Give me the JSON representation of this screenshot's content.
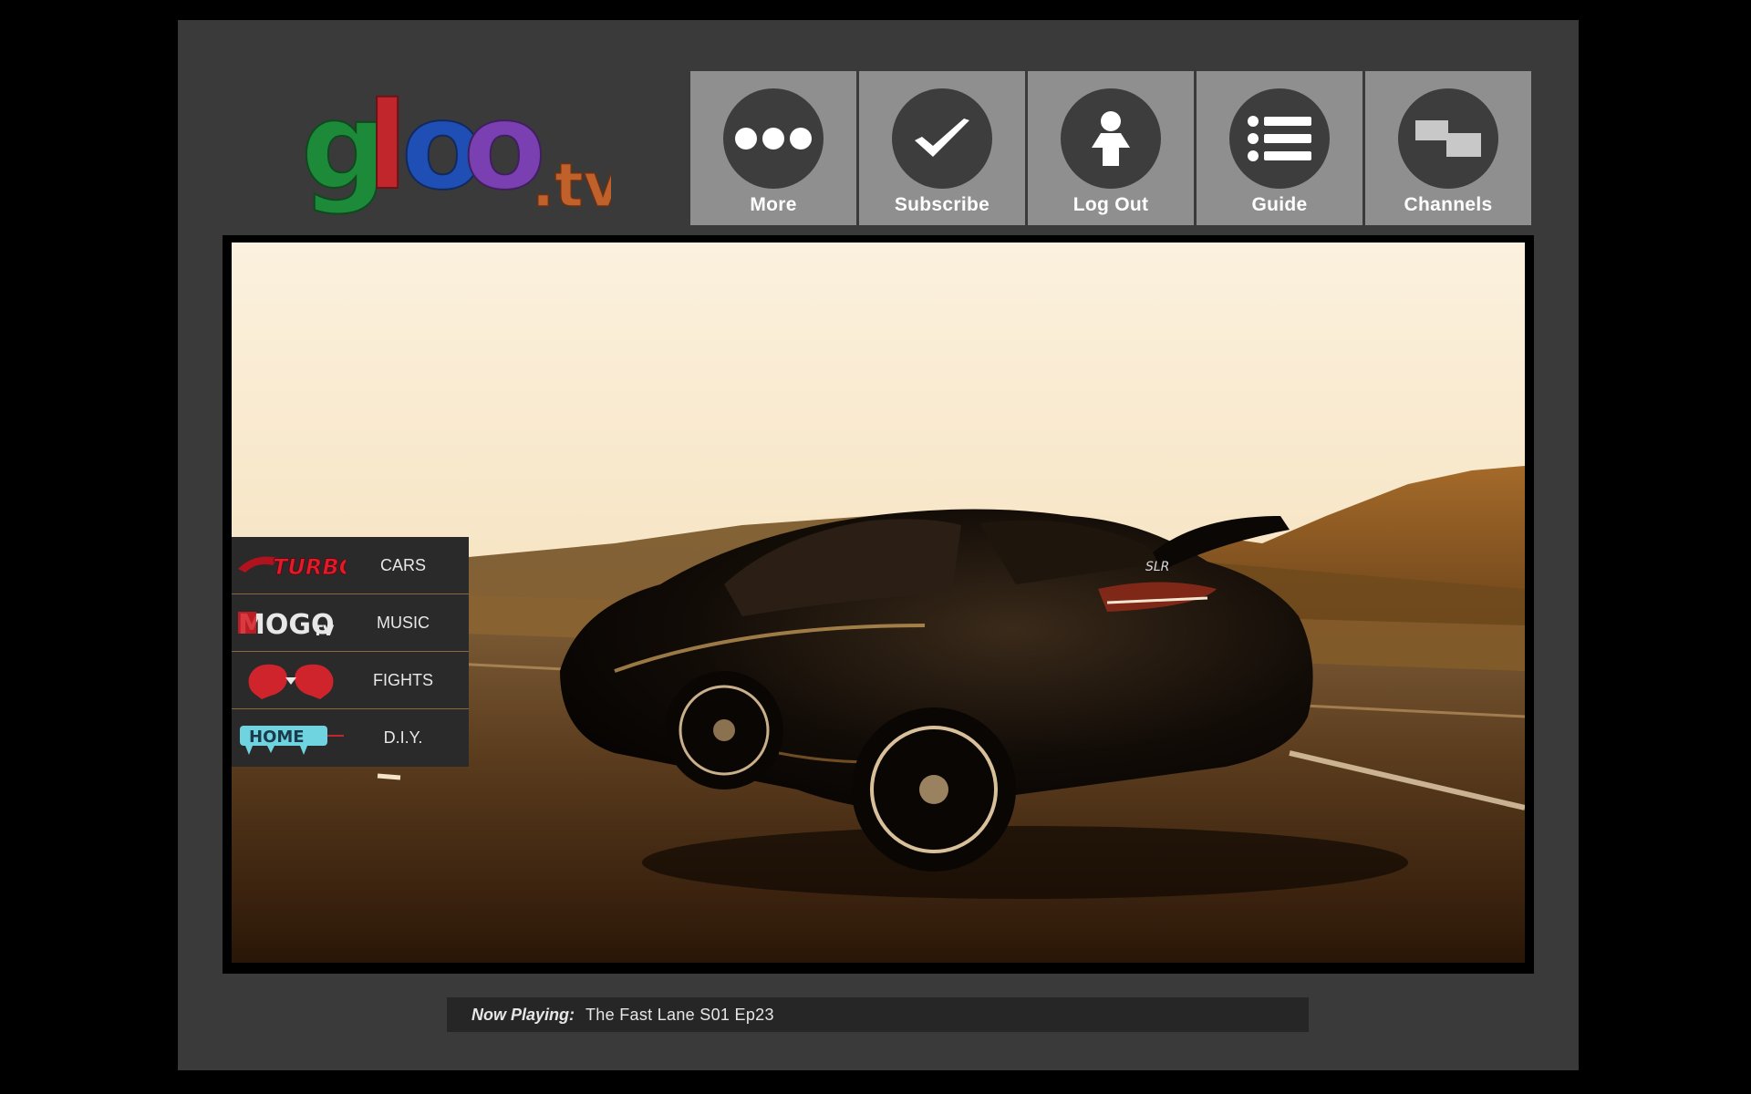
{
  "logo": {
    "main": "gloo",
    "suffix": ".tv",
    "colors": [
      "#1d8a3a",
      "#c0262b",
      "#1f4fb4",
      "#7a3fb0",
      "#c0602a"
    ]
  },
  "nav": [
    {
      "id": "more",
      "label": "More",
      "icon": "more-dots-icon"
    },
    {
      "id": "subscribe",
      "label": "Subscribe",
      "icon": "checkmark-icon"
    },
    {
      "id": "logout",
      "label": "Log Out",
      "icon": "person-icon"
    },
    {
      "id": "guide",
      "label": "Guide",
      "icon": "list-icon"
    },
    {
      "id": "channels",
      "label": "Channels",
      "icon": "channels-icon"
    }
  ],
  "channels": [
    {
      "brand": "TURBO",
      "name": "CARS"
    },
    {
      "brand": "MOGO",
      "brand_suffix": "TV",
      "name": "MUSIC"
    },
    {
      "brand": "",
      "name": "FIGHTS",
      "icon": "boxing-gloves-icon"
    },
    {
      "brand": "HOME",
      "name": "D.I.Y."
    }
  ],
  "now_playing": {
    "label": "Now Playing:",
    "value": "The Fast Lane S01 Ep23"
  },
  "video": {
    "badge": "SLR"
  },
  "colors": {
    "panel": "#3a3a3a",
    "nav_button": "#8f8f8f",
    "nav_circle": "#3d3d3d",
    "channel_divider": "#8a6a3a"
  }
}
